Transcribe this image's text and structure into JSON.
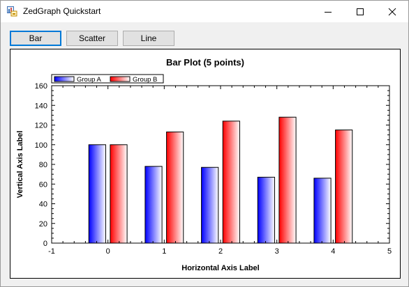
{
  "window": {
    "title": "ZedGraph Quickstart",
    "icons": {
      "app": "app-icon",
      "minimize": "minimize-icon",
      "maximize": "maximize-icon",
      "close": "close-icon"
    }
  },
  "toolbar": {
    "buttons": [
      {
        "label": "Bar",
        "active": true
      },
      {
        "label": "Scatter",
        "active": false
      },
      {
        "label": "Line",
        "active": false
      }
    ]
  },
  "colors": {
    "group_a": "#0000ff",
    "group_b": "#ff0000",
    "accent": "#0078d7"
  },
  "chart_data": {
    "type": "bar",
    "title": "Bar Plot (5 points)",
    "xlabel": "Horizontal Axis Label",
    "ylabel": "Vertical Axis Label",
    "xlim": [
      -1,
      5
    ],
    "ylim": [
      0,
      160
    ],
    "x_ticks": [
      "-1",
      "0",
      "1",
      "2",
      "3",
      "4",
      "5"
    ],
    "y_ticks": [
      "0",
      "20",
      "40",
      "60",
      "80",
      "100",
      "120",
      "140",
      "160"
    ],
    "categories": [
      0,
      1,
      2,
      3,
      4
    ],
    "legend_position": "top-left",
    "grid": false,
    "series": [
      {
        "name": "Group A",
        "values": [
          100,
          78,
          77,
          67,
          66
        ]
      },
      {
        "name": "Group B",
        "values": [
          100,
          113,
          124,
          128,
          115
        ]
      }
    ]
  }
}
